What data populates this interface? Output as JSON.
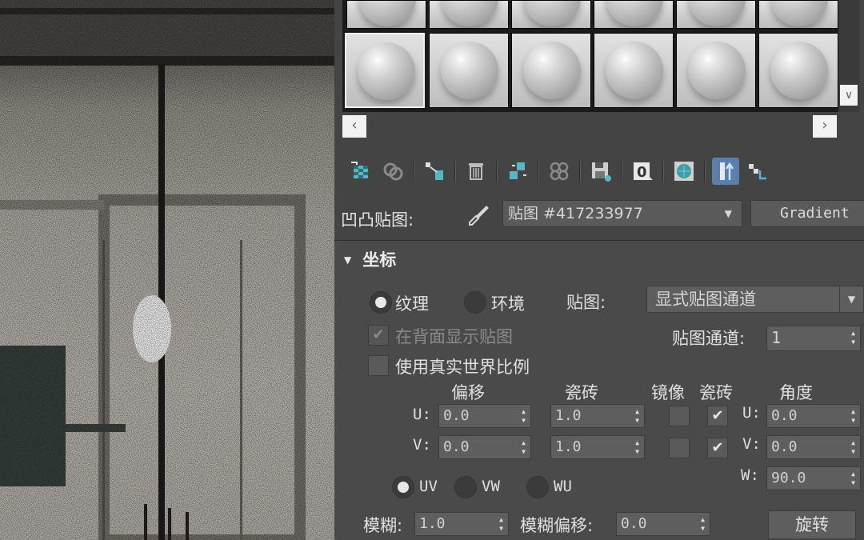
{
  "bump": {
    "label": "凹凸贴图:",
    "map_name": "贴图 #417233977",
    "map_type": "Gradient"
  },
  "coords": {
    "title": "坐标",
    "texture_label": "纹理",
    "env_label": "环境",
    "map_label": "贴图:",
    "map_mode": "显式贴图通道",
    "show_back_label": "在背面显示贴图",
    "map_channel_label": "贴图通道:",
    "map_channel_value": "1",
    "real_world_label": "使用真实世界比例",
    "headers": {
      "offset": "偏移",
      "tiling": "瓷砖",
      "mirror": "镜像",
      "tile": "瓷砖",
      "angle": "角度"
    },
    "u_label": "U:",
    "v_label": "V:",
    "w_label": "W:",
    "u_offset": "0.0",
    "v_offset": "0.0",
    "u_tiling": "1.0",
    "v_tiling": "1.0",
    "u_angle": "0.0",
    "v_angle": "0.0",
    "w_angle": "90.0",
    "uv_label": "UV",
    "vw_label": "VW",
    "wu_label": "WU",
    "blur_label": "模糊:",
    "blur_value": "1.0",
    "blur_offset_label": "模糊偏移:",
    "blur_offset_value": "0.0",
    "rotate_label": "旋转"
  },
  "colors": {
    "panel_bg": "#444444",
    "active_button": "#5a7fa8",
    "accent_icon": "#4fb8c0"
  }
}
